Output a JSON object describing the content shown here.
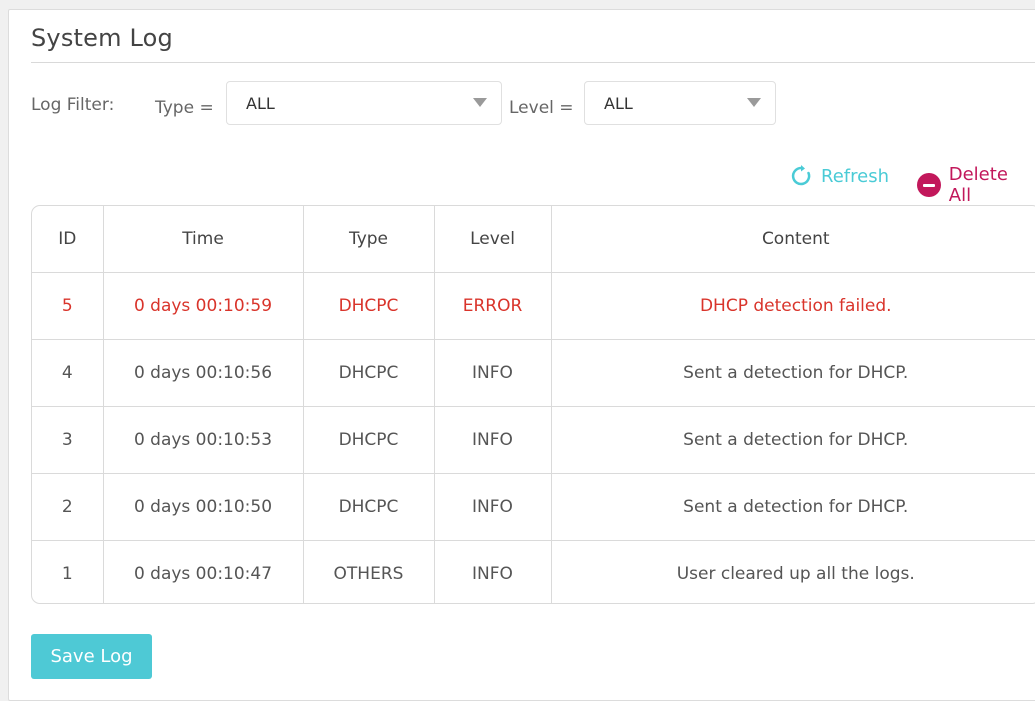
{
  "title": "System Log",
  "filter": {
    "label": "Log Filter:",
    "type_label": "Type =",
    "type_value": "ALL",
    "level_label": "Level =",
    "level_value": "ALL"
  },
  "actions": {
    "refresh_label": "Refresh",
    "delete_all_label": "Delete All",
    "refresh_color": "#4acbd6",
    "delete_color": "#c2185b"
  },
  "table": {
    "headers": [
      "ID",
      "Time",
      "Type",
      "Level",
      "Content"
    ],
    "rows": [
      [
        "5",
        "0 days 00:10:59",
        "DHCPC",
        "ERROR",
        "DHCP detection failed."
      ],
      [
        "4",
        "0 days 00:10:56",
        "DHCPC",
        "INFO",
        "Sent a detection for DHCP."
      ],
      [
        "3",
        "0 days 00:10:53",
        "DHCPC",
        "INFO",
        "Sent a detection for DHCP."
      ],
      [
        "2",
        "0 days 00:10:50",
        "DHCPC",
        "INFO",
        "Sent a detection for DHCP."
      ],
      [
        "1",
        "0 days 00:10:47",
        "OTHERS",
        "INFO",
        "User cleared up all the logs."
      ]
    ],
    "error_color": "#d9342b"
  },
  "save_label": "Save Log",
  "accent_color": "#4ec9d5"
}
